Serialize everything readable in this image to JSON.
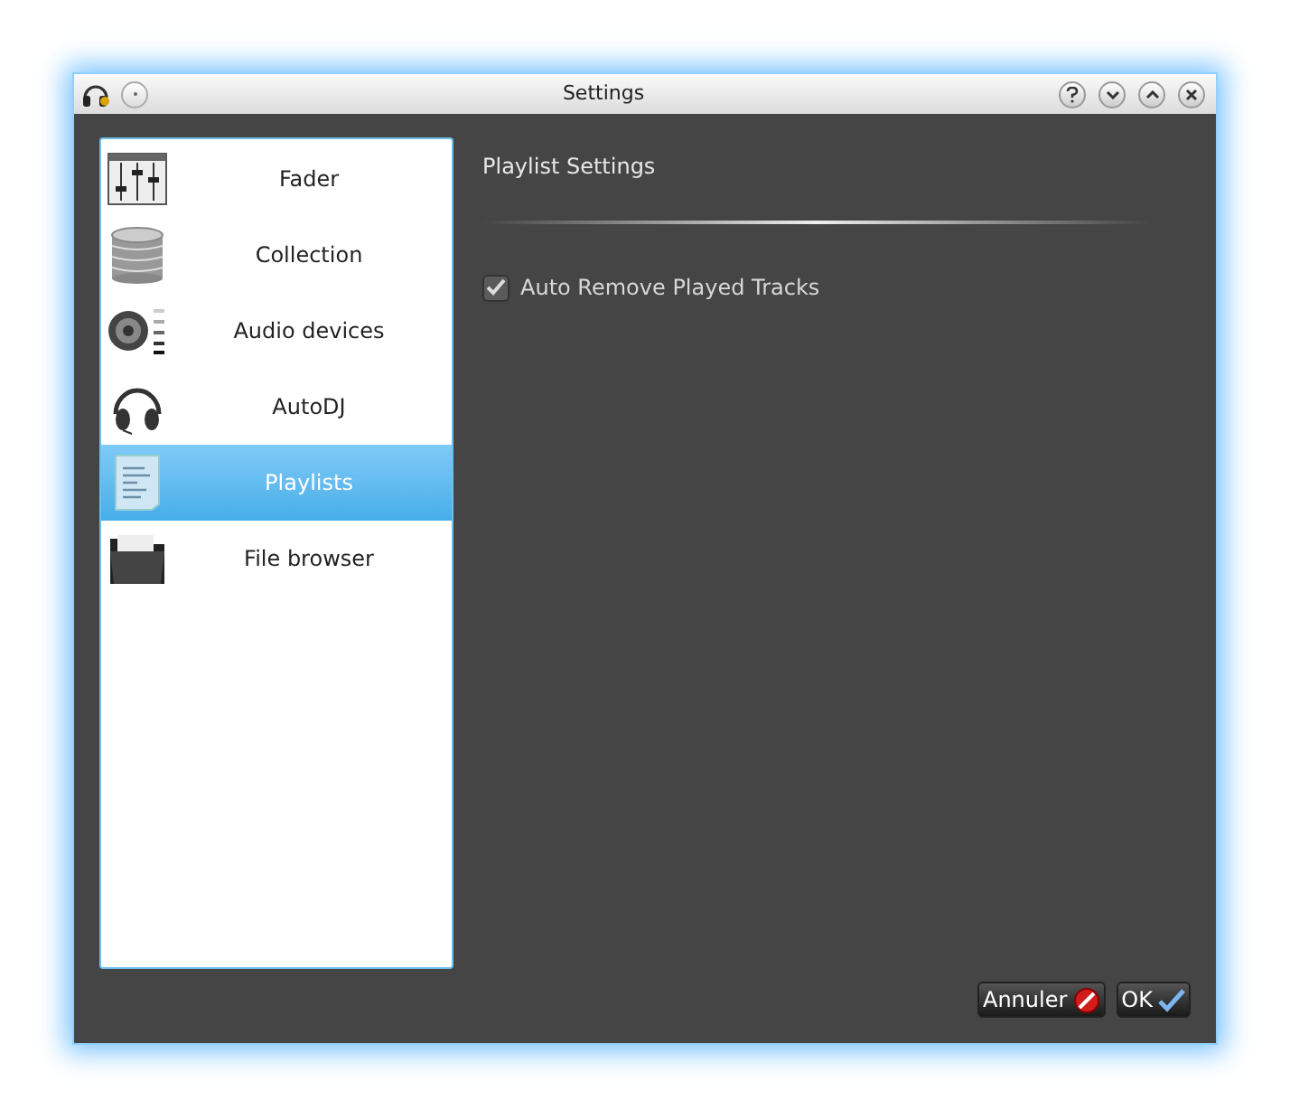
{
  "window": {
    "title": "Settings"
  },
  "sidebar": {
    "items": [
      {
        "label": "Fader",
        "selected": false
      },
      {
        "label": "Collection",
        "selected": false
      },
      {
        "label": "Audio devices",
        "selected": false
      },
      {
        "label": "AutoDJ",
        "selected": false
      },
      {
        "label": "Playlists",
        "selected": true
      },
      {
        "label": "File browser",
        "selected": false
      }
    ]
  },
  "panel": {
    "title": "Playlist Settings",
    "options": [
      {
        "label": "Auto Remove Played Tracks",
        "checked": true
      }
    ]
  },
  "buttons": [
    {
      "label": "Annuler",
      "kind": "cancel"
    },
    {
      "label": "OK",
      "kind": "ok"
    }
  ]
}
